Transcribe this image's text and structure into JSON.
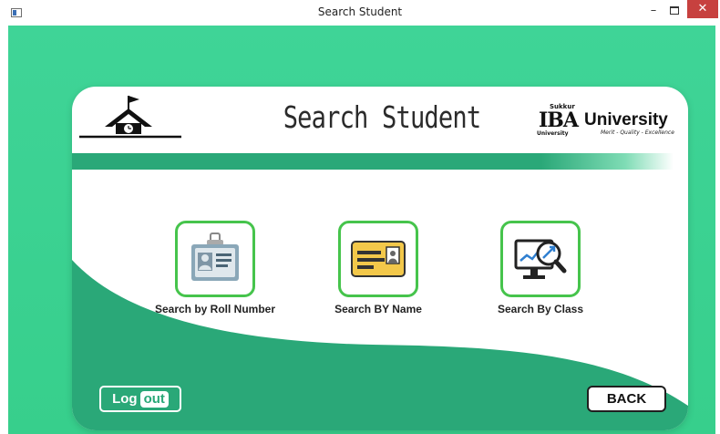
{
  "window": {
    "title": "Search Student",
    "minimize_glyph": "–",
    "close_glyph": "✕"
  },
  "header": {
    "title": "Search Student",
    "logo": {
      "sukkur": "Sukkur",
      "mark": "IBA",
      "univ_small": "University",
      "name": "University",
      "tagline": "Merit - Quality - Excellence"
    }
  },
  "options": [
    {
      "label": "Search by Roll Number",
      "icon": "id-badge-icon"
    },
    {
      "label": "Search BY Name",
      "icon": "id-card-icon"
    },
    {
      "label": "Search By Class",
      "icon": "monitor-search-icon"
    }
  ],
  "footer": {
    "logout_log": "Log",
    "logout_out": "out",
    "back_label": "BACK"
  },
  "colors": {
    "background_green": "#3fd497",
    "accent_green": "#2aa878",
    "tile_border": "#46c44c",
    "close_red": "#c7413f"
  }
}
